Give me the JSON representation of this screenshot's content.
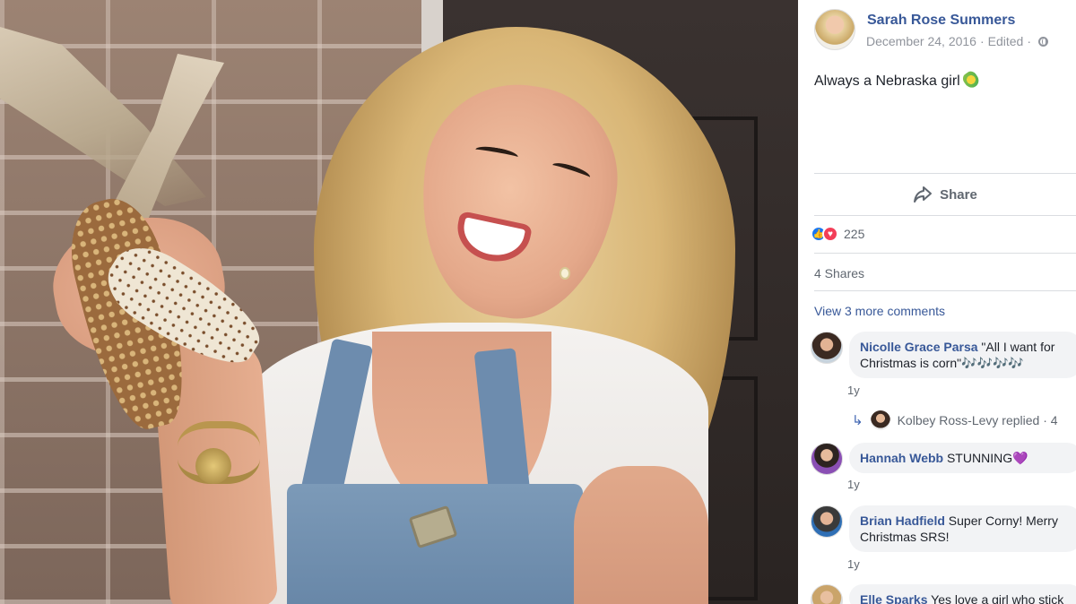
{
  "post": {
    "author": "Sarah Rose Summers",
    "date": "December 24, 2016",
    "edited": "Edited",
    "caption": "Always a Nebraska girl",
    "caption_emoji": "corn-emoji"
  },
  "actions": {
    "share_label": "Share"
  },
  "stats": {
    "reaction_count": "225",
    "shares": "4 Shares"
  },
  "comments": {
    "view_more": "View 3 more comments",
    "items": [
      {
        "name": "Nicolle Grace Parsa",
        "text": "\"All I want for Christmas is corn\"🎶🎶🎶🎶",
        "time": "1y"
      },
      {
        "name": "Hannah Webb",
        "text": "STUNNING💜",
        "time": "1y"
      },
      {
        "name": "Brian Hadfield",
        "text": "Super Corny! Merry Christmas SRS!",
        "time": "1y"
      },
      {
        "name": "Elle Sparks",
        "text": "Yes love a girl who stick"
      }
    ],
    "reply": {
      "name": "Kolbey Ross-Levy",
      "text": "replied · 4"
    }
  },
  "colors": {
    "link_blue": "#385898",
    "meta_gray": "#90949c",
    "bubble_bg": "#f2f3f5",
    "like_blue": "#1877f2",
    "love_red": "#f33e58"
  }
}
